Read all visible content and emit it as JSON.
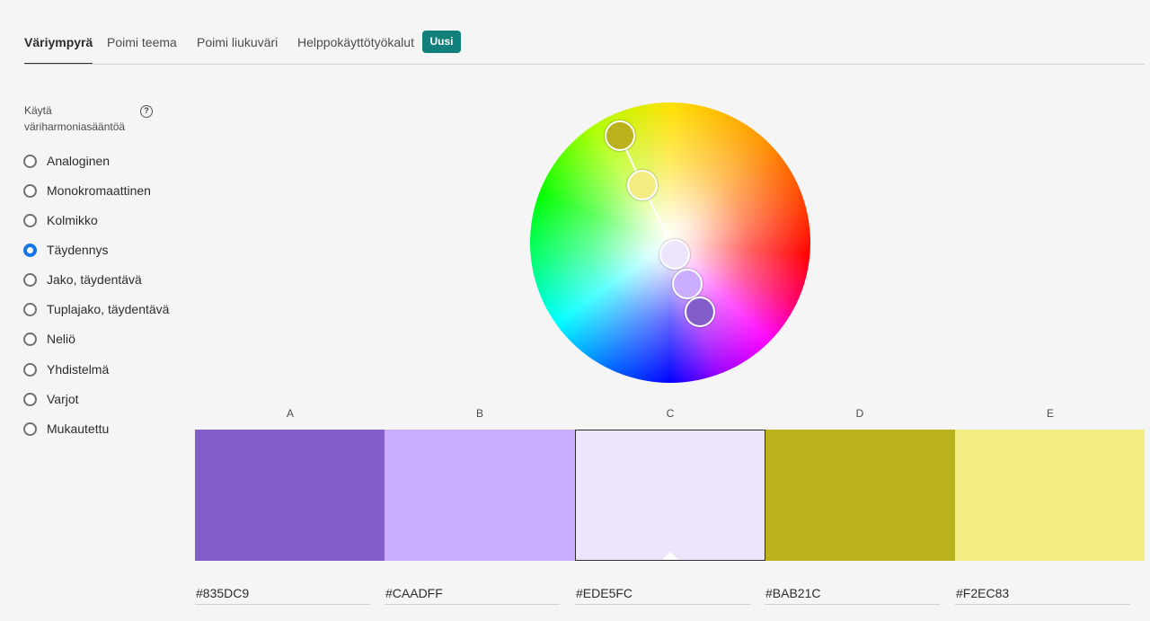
{
  "tabs": [
    {
      "label": "Väriympyrä",
      "active": true
    },
    {
      "label": "Poimi teema"
    },
    {
      "label": "Poimi liukuväri"
    },
    {
      "label": "Helppokäyttötyökalut"
    }
  ],
  "badge": "Uusi",
  "sidebar": {
    "title": "Käytä väriharmoniasääntöä",
    "help_icon": "?",
    "rules": [
      {
        "label": "Analoginen"
      },
      {
        "label": "Monokromaattinen"
      },
      {
        "label": "Kolmikko"
      },
      {
        "label": "Täydennys",
        "checked": true
      },
      {
        "label": "Jako, täydentävä"
      },
      {
        "label": "Tuplajako, täydentävä"
      },
      {
        "label": "Neliö"
      },
      {
        "label": "Yhdistelmä"
      },
      {
        "label": "Varjot"
      },
      {
        "label": "Mukautettu"
      }
    ]
  },
  "swatches": [
    {
      "letter": "A",
      "hex": "#835DC9"
    },
    {
      "letter": "B",
      "hex": "#CAADFF"
    },
    {
      "letter": "C",
      "hex": "#EDE5FC",
      "selected": true
    },
    {
      "letter": "D",
      "hex": "#BAB21C"
    },
    {
      "letter": "E",
      "hex": "#F2EC83"
    }
  ]
}
